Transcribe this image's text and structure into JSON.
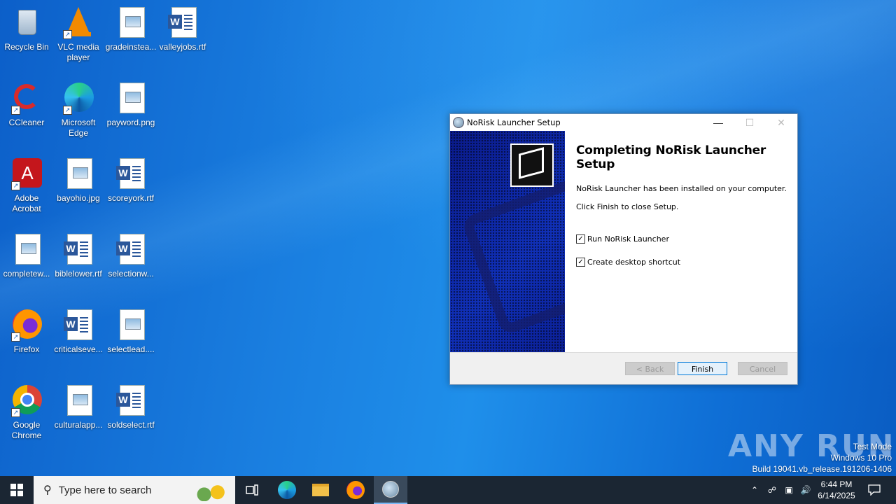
{
  "desktop": {
    "icons": [
      {
        "label": "Recycle Bin"
      },
      {
        "label": "VLC media player"
      },
      {
        "label": "gradeinstea..."
      },
      {
        "label": "valleyjobs.rtf"
      },
      {
        "label": "CCleaner"
      },
      {
        "label": "Microsoft Edge"
      },
      {
        "label": "payword.png"
      },
      {
        "label": "Adobe Acrobat"
      },
      {
        "label": "bayohio.jpg"
      },
      {
        "label": "scoreyork.rtf"
      },
      {
        "label": "completew..."
      },
      {
        "label": "biblelower.rtf"
      },
      {
        "label": "selectionw..."
      },
      {
        "label": "Firefox"
      },
      {
        "label": "criticalseve..."
      },
      {
        "label": "selectlead...."
      },
      {
        "label": "Google Chrome"
      },
      {
        "label": "culturalapp..."
      },
      {
        "label": "soldselect.rtf"
      }
    ]
  },
  "dialog": {
    "title": "NoRisk Launcher Setup",
    "heading": "Completing NoRisk Launcher Setup",
    "installed_text": "NoRisk Launcher has been installed on your computer.",
    "close_text": "Click Finish to close Setup.",
    "checkbox_run": {
      "label": "Run NoRisk Launcher",
      "checked": true
    },
    "checkbox_shortcut": {
      "label": "Create desktop shortcut",
      "checked": true
    },
    "buttons": {
      "back": "< Back",
      "finish": "Finish",
      "cancel": "Cancel"
    }
  },
  "watermark": {
    "brand": "ANY RUN",
    "line1": "Test Mode",
    "line2": "Windows 10 Pro",
    "line3": "Build 19041.vb_release.191206-1406"
  },
  "taskbar": {
    "search_placeholder": "Type here to search",
    "time": "6:44 PM",
    "date": "6/14/2025"
  }
}
